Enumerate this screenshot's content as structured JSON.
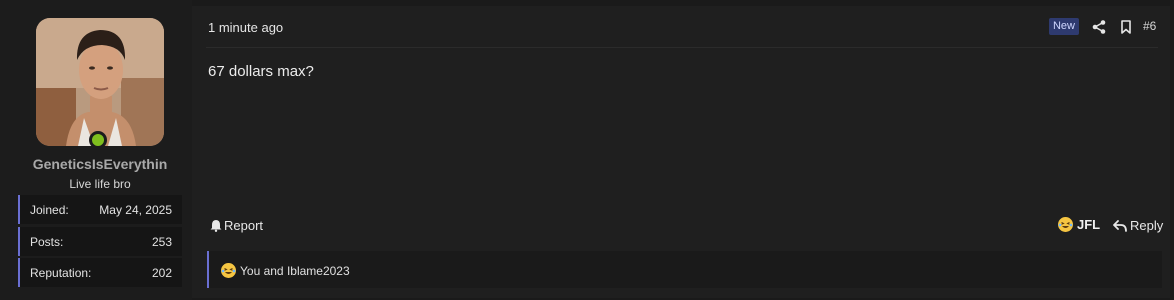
{
  "post": {
    "time": "1 minute ago",
    "badge": "New",
    "number": "#6",
    "message": "67 dollars max?",
    "actions": {
      "report": "Report",
      "reaction": "JFL",
      "reply": "Reply"
    },
    "reactions_summary": "You and Iblame2023"
  },
  "user": {
    "name": "GeneticsIsEverythin",
    "title": "Live life bro",
    "online": true,
    "stats": [
      {
        "key": "Joined:",
        "value": "May 24, 2025"
      },
      {
        "key": "Posts:",
        "value": "253"
      },
      {
        "key": "Reputation:",
        "value": "202"
      }
    ]
  },
  "colors": {
    "accent": "#6a6fd2",
    "online": "#7fbf1e",
    "badge_bg": "#2e3a6f"
  },
  "icons": [
    "share-icon",
    "bookmark-icon",
    "bell-icon",
    "laughing-emoji-icon",
    "reply-arrow-icon"
  ]
}
